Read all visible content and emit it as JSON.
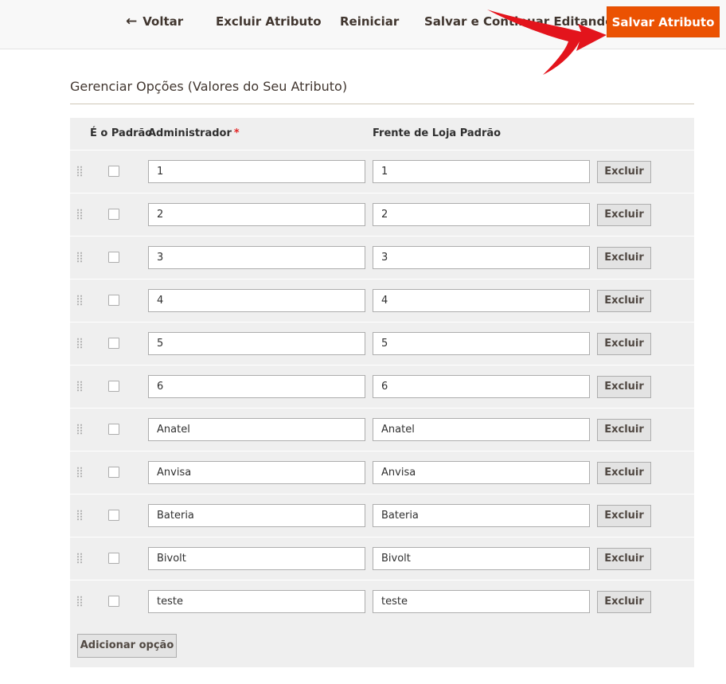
{
  "toolbar": {
    "back_label": "Voltar",
    "delete_label": "Excluir Atributo",
    "reset_label": "Reiniciar",
    "save_continue_label": "Salvar e Continuar Editando",
    "save_label": "Salvar Atributo"
  },
  "section": {
    "title": "Gerenciar Opções (Valores do Seu Atributo)"
  },
  "table": {
    "col_default": "É o Padrão",
    "col_admin": "Administrador",
    "col_admin_required_mark": "*",
    "col_store": "Frente de Loja Padrão",
    "delete_label": "Excluir",
    "add_option_label": "Adicionar opção",
    "rows": [
      {
        "admin": "1",
        "store": "1",
        "is_default": false
      },
      {
        "admin": "2",
        "store": "2",
        "is_default": false
      },
      {
        "admin": "3",
        "store": "3",
        "is_default": false
      },
      {
        "admin": "4",
        "store": "4",
        "is_default": false
      },
      {
        "admin": "5",
        "store": "5",
        "is_default": false
      },
      {
        "admin": "6",
        "store": "6",
        "is_default": false
      },
      {
        "admin": "Anatel",
        "store": "Anatel",
        "is_default": false
      },
      {
        "admin": "Anvisa",
        "store": "Anvisa",
        "is_default": false
      },
      {
        "admin": "Bateria",
        "store": "Bateria",
        "is_default": false
      },
      {
        "admin": "Bivolt",
        "store": "Bivolt",
        "is_default": false
      },
      {
        "admin": "teste",
        "store": "teste",
        "is_default": false
      }
    ]
  },
  "colors": {
    "primary": "#eb5202",
    "annotation_arrow": "#e3141c"
  },
  "icons": {
    "back": "arrow-left-icon",
    "drag": "drag-handle-icon",
    "annotation": "red-arrow-annotation"
  }
}
